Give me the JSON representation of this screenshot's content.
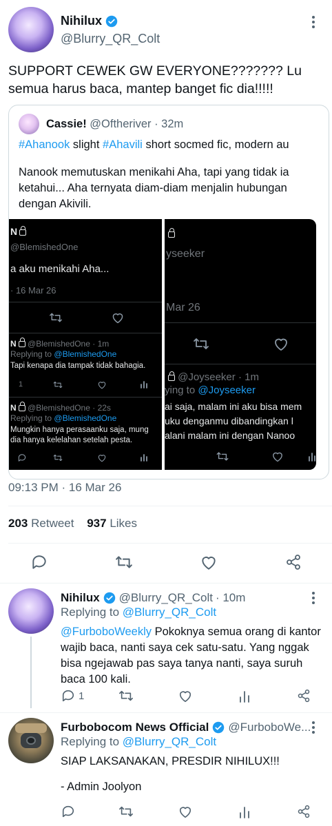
{
  "main_tweet": {
    "name": "Nihilux",
    "handle": "@Blurry_QR_Colt",
    "text": "SUPPORT CEWEK GW EVERYONE??????? Lu semua harus baca, mantep banget fic dia!!!!!",
    "timestamp": "09:13 PM · 16 Mar 26",
    "retweets_count": "203",
    "retweets_label": "Retweet",
    "likes_count": "937",
    "likes_label": "Likes"
  },
  "quoted_tweet": {
    "name": "Cassie!",
    "handle": "@Oftheriver",
    "time": "· 32m",
    "hashtag1": "#Ahanook",
    "word1": "slight",
    "hashtag2": "#Ahavili",
    "rest1": "short socmed fic, modern au",
    "body": "Nanook memutuskan menikahi Aha, tapi yang tidak ia ketahui... Aha ternyata diam-diam menjalin hubungan dengan Akivili."
  },
  "screenshot_left": {
    "name_initial": "N",
    "handle": "@BlemishedOne",
    "text": "a aku menikahi Aha...",
    "date": "· 16 Mar 26",
    "reply1": {
      "name_initial": "N",
      "handle": "@BlemishedOne",
      "time": "· 1m",
      "replying_prefix": "Replying to",
      "replying_handle": "@BlemishedOne",
      "text": "Tapi kenapa dia tampak tidak bahagia.",
      "reply_count": "1"
    },
    "reply2": {
      "name_initial": "N",
      "handle": "@BlemishedOne",
      "time": "· 22s",
      "replying_prefix": "Replying to",
      "replying_handle": "@BlemishedOne",
      "text_line1": "Mungkin hanya perasaanku saja, mung",
      "text_line2": "dia hanya kelelahan setelah pesta."
    }
  },
  "screenshot_right": {
    "handle_partial": "yseeker",
    "date": "Mar 26",
    "reply": {
      "handle": "@Joyseeker",
      "time": "· 1m",
      "replying_prefix": "ying to",
      "replying_handle": "@Joyseeker",
      "line1": "ai saja, malam ini aku bisa mem",
      "line2": "uku denganmu dibandingkan l",
      "line3": "alani malam ini dengan Nanoo"
    }
  },
  "reply1": {
    "name": "Nihilux",
    "handle": "@Blurry_QR_Colt",
    "time": "· 10m",
    "replying_prefix": "Replying to",
    "replying_handle": "@Blurry_QR_Colt",
    "mention": "@FurboboWeekly",
    "text_rest": "Pokoknya semua orang di kantor wajib baca, nanti saya cek satu-satu. Yang nggak bisa ngejawab pas saya tanya nanti, saya suruh baca 100 kali.",
    "reply_count": "1"
  },
  "reply2": {
    "name": "Furbobocom News Official",
    "handle": "@FurboboWe...",
    "replying_prefix": "Replying to",
    "replying_handle": "@Blurry_QR_Colt",
    "text1": "SIAP LAKSANAKAN, PRESDIR NIHILUX!!!",
    "text2": "- Admin Joolyon"
  },
  "colors": {
    "accent": "#1d9bf0",
    "secondary_text": "#536471",
    "divider": "#eff3f4"
  }
}
